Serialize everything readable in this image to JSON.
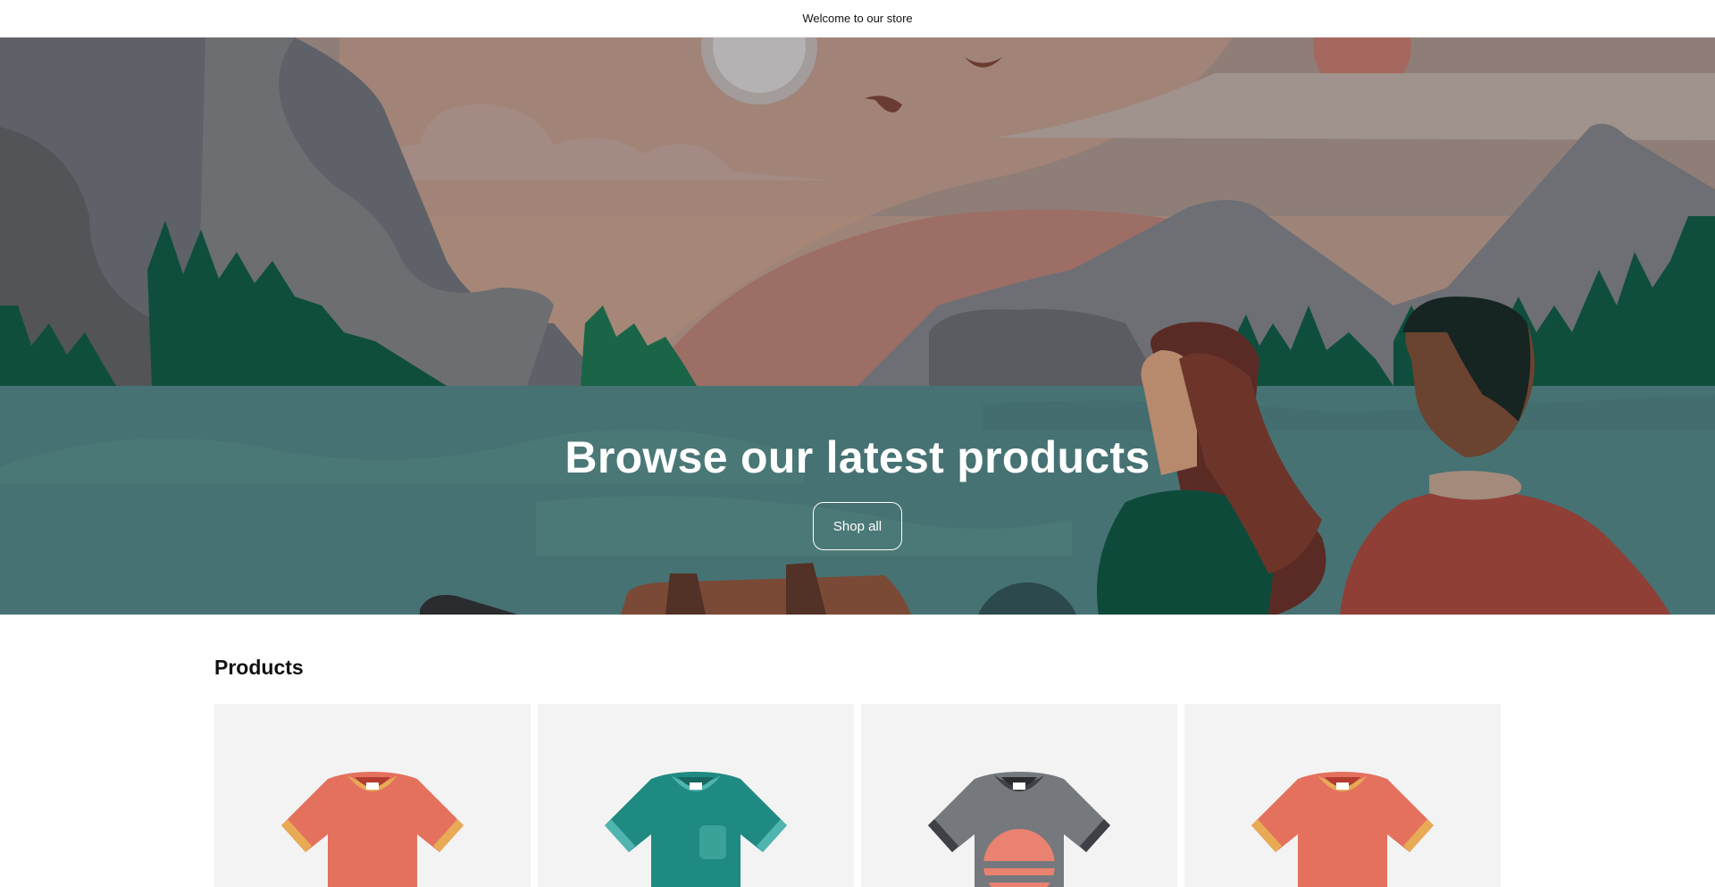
{
  "announcement": {
    "text": "Welcome to our store"
  },
  "hero": {
    "title": "Browse our latest products",
    "button_label": "Shop all"
  },
  "products": {
    "heading": "Products",
    "items": [
      {
        "icon": "coral-tshirt-icon",
        "color": "#e3715e",
        "trim": "#e8aa55"
      },
      {
        "icon": "teal-tshirt-icon",
        "color": "#1f8a82",
        "trim": "#4fb5ae"
      },
      {
        "icon": "gray-tshirt-icon",
        "color": "#75787d",
        "trim": "#3e4045"
      },
      {
        "icon": "coral-tshirt-icon",
        "color": "#e3715e",
        "trim": "#e8aa55"
      }
    ]
  }
}
